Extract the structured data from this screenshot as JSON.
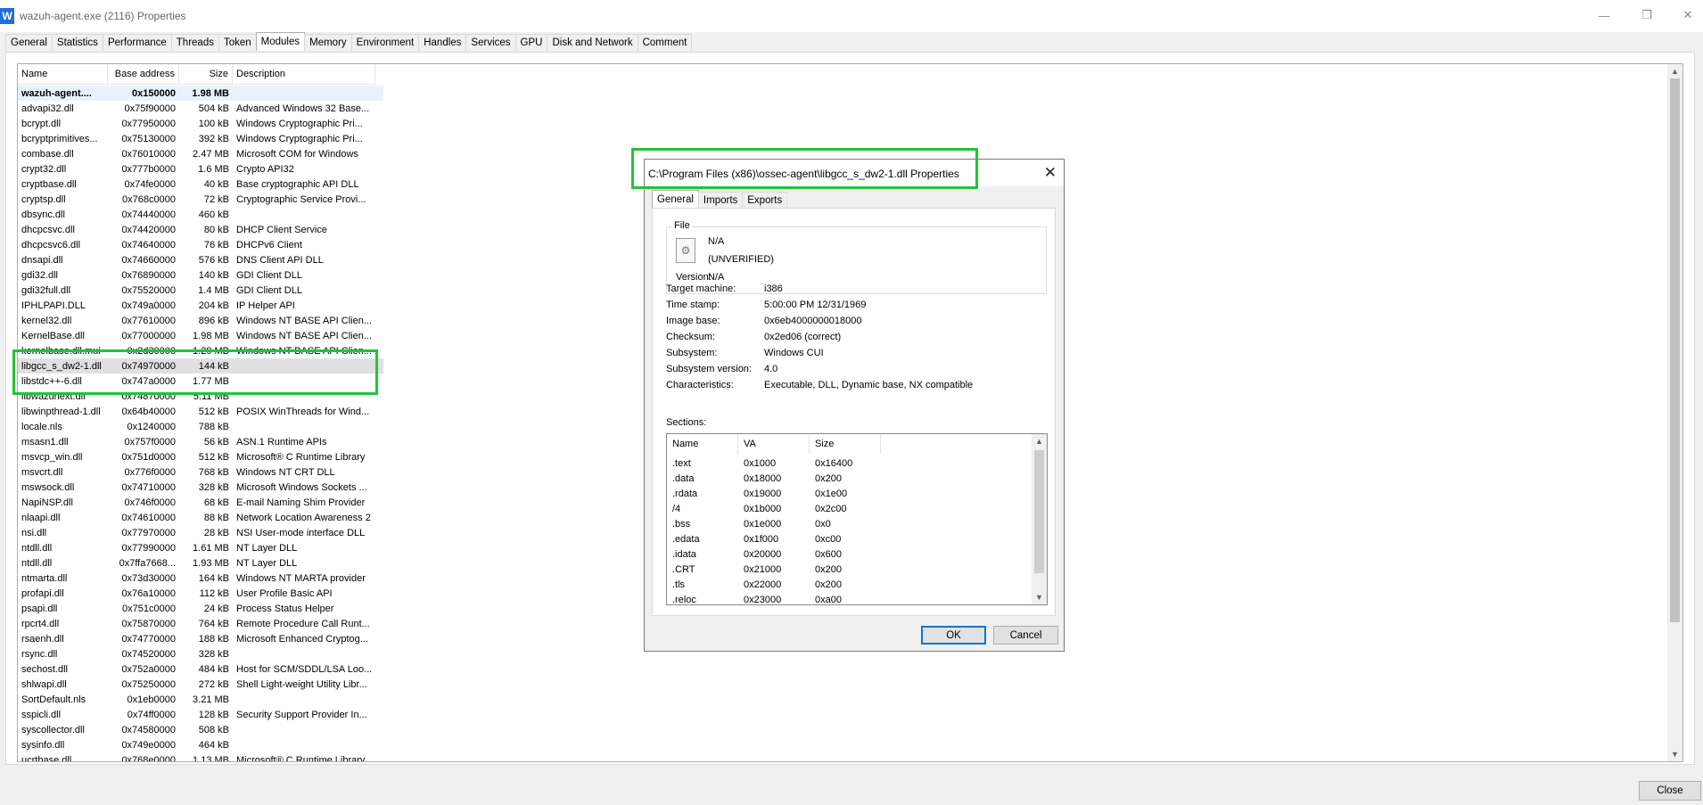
{
  "window": {
    "title": "wazuh-agent.exe (2116) Properties",
    "app_icon": "W",
    "close_label": "Close"
  },
  "tabs": [
    "General",
    "Statistics",
    "Performance",
    "Threads",
    "Token",
    "Modules",
    "Memory",
    "Environment",
    "Handles",
    "Services",
    "GPU",
    "Disk and Network",
    "Comment"
  ],
  "modules": {
    "columns": [
      "Name",
      "Base address",
      "Size",
      "Description"
    ],
    "rows": [
      {
        "name": "wazuh-agent....",
        "base": "0x150000",
        "size": "1.98 MB",
        "desc": ""
      },
      {
        "name": "advapi32.dll",
        "base": "0x75f90000",
        "size": "504 kB",
        "desc": "Advanced Windows 32 Base..."
      },
      {
        "name": "bcrypt.dll",
        "base": "0x77950000",
        "size": "100 kB",
        "desc": "Windows Cryptographic Pri..."
      },
      {
        "name": "bcryptprimitives...",
        "base": "0x75130000",
        "size": "392 kB",
        "desc": "Windows Cryptographic Pri..."
      },
      {
        "name": "combase.dll",
        "base": "0x76010000",
        "size": "2.47 MB",
        "desc": "Microsoft COM for Windows"
      },
      {
        "name": "crypt32.dll",
        "base": "0x777b0000",
        "size": "1.6 MB",
        "desc": "Crypto API32"
      },
      {
        "name": "cryptbase.dll",
        "base": "0x74fe0000",
        "size": "40 kB",
        "desc": "Base cryptographic API DLL"
      },
      {
        "name": "cryptsp.dll",
        "base": "0x768c0000",
        "size": "72 kB",
        "desc": "Cryptographic Service Provi..."
      },
      {
        "name": "dbsync.dll",
        "base": "0x74440000",
        "size": "460 kB",
        "desc": ""
      },
      {
        "name": "dhcpcsvc.dll",
        "base": "0x74420000",
        "size": "80 kB",
        "desc": "DHCP Client Service"
      },
      {
        "name": "dhcpcsvc6.dll",
        "base": "0x74640000",
        "size": "76 kB",
        "desc": "DHCPv6 Client"
      },
      {
        "name": "dnsapi.dll",
        "base": "0x74660000",
        "size": "576 kB",
        "desc": "DNS Client API DLL"
      },
      {
        "name": "gdi32.dll",
        "base": "0x76890000",
        "size": "140 kB",
        "desc": "GDI Client DLL"
      },
      {
        "name": "gdi32full.dll",
        "base": "0x75520000",
        "size": "1.4 MB",
        "desc": "GDI Client DLL"
      },
      {
        "name": "IPHLPAPI.DLL",
        "base": "0x749a0000",
        "size": "204 kB",
        "desc": "IP Helper API"
      },
      {
        "name": "kernel32.dll",
        "base": "0x77610000",
        "size": "896 kB",
        "desc": "Windows NT BASE API Clien..."
      },
      {
        "name": "KernelBase.dll",
        "base": "0x77000000",
        "size": "1.98 MB",
        "desc": "Windows NT BASE API Clien..."
      },
      {
        "name": "kernelbase.dll.mui",
        "base": "0x2d30000",
        "size": "1.29 MB",
        "desc": "Windows NT BASE API Clien..."
      },
      {
        "name": "libgcc_s_dw2-1.dll",
        "base": "0x74970000",
        "size": "144 kB",
        "desc": ""
      },
      {
        "name": "libstdc++-6.dll",
        "base": "0x747a0000",
        "size": "1.77 MB",
        "desc": ""
      },
      {
        "name": "libwazuhext.dll",
        "base": "0x74870000",
        "size": "5.11 MB",
        "desc": ""
      },
      {
        "name": "libwinpthread-1.dll",
        "base": "0x64b40000",
        "size": "512 kB",
        "desc": "POSIX WinThreads for Wind..."
      },
      {
        "name": "locale.nls",
        "base": "0x1240000",
        "size": "788 kB",
        "desc": ""
      },
      {
        "name": "msasn1.dll",
        "base": "0x757f0000",
        "size": "56 kB",
        "desc": "ASN.1 Runtime APIs"
      },
      {
        "name": "msvcp_win.dll",
        "base": "0x751d0000",
        "size": "512 kB",
        "desc": "Microsoft® C Runtime Library"
      },
      {
        "name": "msvcrt.dll",
        "base": "0x776f0000",
        "size": "768 kB",
        "desc": "Windows NT CRT DLL"
      },
      {
        "name": "mswsock.dll",
        "base": "0x74710000",
        "size": "328 kB",
        "desc": "Microsoft Windows Sockets ..."
      },
      {
        "name": "NapiNSP.dll",
        "base": "0x746f0000",
        "size": "68 kB",
        "desc": "E-mail Naming Shim Provider"
      },
      {
        "name": "nlaapi.dll",
        "base": "0x74610000",
        "size": "88 kB",
        "desc": "Network Location Awareness 2"
      },
      {
        "name": "nsi.dll",
        "base": "0x77970000",
        "size": "28 kB",
        "desc": "NSI User-mode interface DLL"
      },
      {
        "name": "ntdll.dll",
        "base": "0x77990000",
        "size": "1.61 MB",
        "desc": "NT Layer DLL"
      },
      {
        "name": "ntdll.dll",
        "base": "0x7ffa7668...",
        "size": "1.93 MB",
        "desc": "NT Layer DLL"
      },
      {
        "name": "ntmarta.dll",
        "base": "0x73d30000",
        "size": "164 kB",
        "desc": "Windows NT MARTA provider"
      },
      {
        "name": "profapi.dll",
        "base": "0x76a10000",
        "size": "112 kB",
        "desc": "User Profile Basic API"
      },
      {
        "name": "psapi.dll",
        "base": "0x751c0000",
        "size": "24 kB",
        "desc": "Process Status Helper"
      },
      {
        "name": "rpcrt4.dll",
        "base": "0x75870000",
        "size": "764 kB",
        "desc": "Remote Procedure Call Runt..."
      },
      {
        "name": "rsaenh.dll",
        "base": "0x74770000",
        "size": "188 kB",
        "desc": "Microsoft Enhanced Cryptog..."
      },
      {
        "name": "rsync.dll",
        "base": "0x74520000",
        "size": "328 kB",
        "desc": ""
      },
      {
        "name": "sechost.dll",
        "base": "0x752a0000",
        "size": "484 kB",
        "desc": "Host for SCM/SDDL/LSA Loo..."
      },
      {
        "name": "shlwapi.dll",
        "base": "0x75250000",
        "size": "272 kB",
        "desc": "Shell Light-weight Utility Libr..."
      },
      {
        "name": "SortDefault.nls",
        "base": "0x1eb0000",
        "size": "3.21 MB",
        "desc": ""
      },
      {
        "name": "sspicli.dll",
        "base": "0x74ff0000",
        "size": "128 kB",
        "desc": "Security Support Provider In..."
      },
      {
        "name": "syscollector.dll",
        "base": "0x74580000",
        "size": "508 kB",
        "desc": ""
      },
      {
        "name": "sysinfo.dll",
        "base": "0x749e0000",
        "size": "464 kB",
        "desc": ""
      },
      {
        "name": "ucrtbase.dll",
        "base": "0x768e0000",
        "size": "1.13 MB",
        "desc": "Microsoft® C Runtime Library"
      }
    ]
  },
  "dialog": {
    "title": "C:\\Program Files (x86)\\ossec-agent\\libgcc_s_dw2-1.dll Properties",
    "tabs": [
      "General",
      "Imports",
      "Exports"
    ],
    "file_group_label": "File",
    "file_name": "N/A",
    "file_status": "(UNVERIFIED)",
    "version_label": "Version:",
    "version_value": "N/A",
    "props": [
      {
        "label": "Target machine:",
        "value": "i386"
      },
      {
        "label": "Time stamp:",
        "value": "5:00:00 PM 12/31/1969"
      },
      {
        "label": "Image base:",
        "value": "0x6eb4000000018000"
      },
      {
        "label": "Checksum:",
        "value": "0x2ed06 (correct)"
      },
      {
        "label": "Subsystem:",
        "value": "Windows CUI"
      },
      {
        "label": "Subsystem version:",
        "value": "4.0"
      },
      {
        "label": "Characteristics:",
        "value": "Executable, DLL, Dynamic base, NX compatible"
      }
    ],
    "sections_label": "Sections:",
    "sections_columns": [
      "Name",
      "VA",
      "Size"
    ],
    "sections": [
      {
        "name": ".text",
        "va": "0x1000",
        "size": "0x16400"
      },
      {
        "name": ".data",
        "va": "0x18000",
        "size": "0x200"
      },
      {
        "name": ".rdata",
        "va": "0x19000",
        "size": "0x1e00"
      },
      {
        "name": "/4",
        "va": "0x1b000",
        "size": "0x2c00"
      },
      {
        "name": ".bss",
        "va": "0x1e000",
        "size": "0x0"
      },
      {
        "name": ".edata",
        "va": "0x1f000",
        "size": "0xc00"
      },
      {
        "name": ".idata",
        "va": "0x20000",
        "size": "0x600"
      },
      {
        "name": ".CRT",
        "va": "0x21000",
        "size": "0x200"
      },
      {
        "name": ".tls",
        "va": "0x22000",
        "size": "0x200"
      },
      {
        "name": ".reloc",
        "va": "0x23000",
        "size": "0xa00"
      }
    ],
    "ok_label": "OK",
    "cancel_label": "Cancel",
    "close_glyph": "✕"
  },
  "colors": {
    "highlight_box": "#22c33a",
    "accent": "#0078d7",
    "selected_row": "#e0e0e0"
  }
}
